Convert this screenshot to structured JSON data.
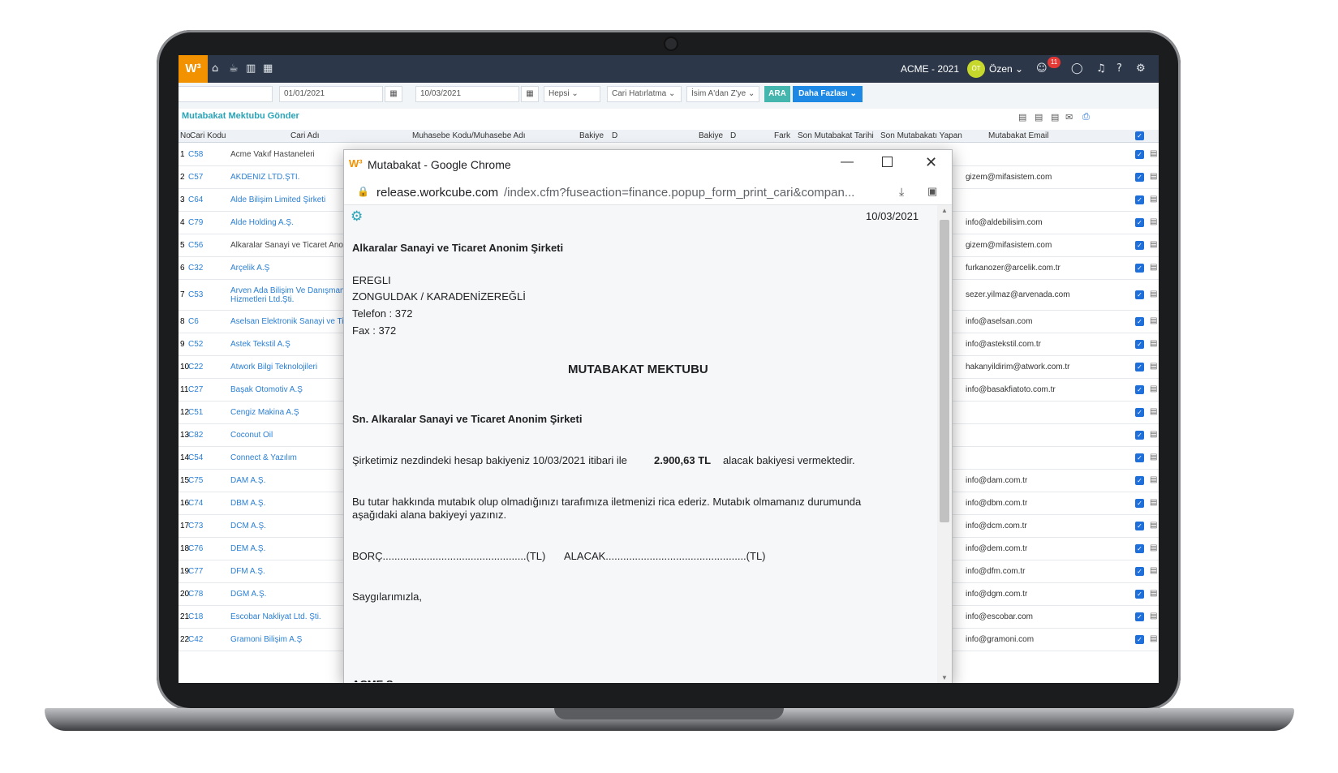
{
  "topbar": {
    "logo": "W³",
    "company": "ACME - 2021",
    "avatar": "ÖT",
    "user": "Özen ⌄",
    "badge": "11"
  },
  "filters": {
    "search": "",
    "date1": "01/01/2021",
    "date2": "10/03/2021",
    "type": "Hepsi",
    "reminder": "Cari Hatırlatma",
    "sort": "İsim A'dan Z'ye",
    "search_button": "ARA",
    "more_button": "Daha Fazlası"
  },
  "page_title": "Mutabakat Mektubu Gönder",
  "table": {
    "headers": [
      "No",
      "Cari Kodu",
      "Cari Adı",
      "Muhasebe Kodu/Muhasebe Adı",
      "Bakiye",
      "D",
      "Bakiye",
      "D",
      "Fark",
      "Son Mutabakat Tarihi",
      "Son Mutabakatı Yapan",
      "Mutabakat Email"
    ],
    "rows": [
      {
        "no": "1",
        "code": "C58",
        "name": "Acme Vakıf Hastaneleri",
        "email": ""
      },
      {
        "no": "2",
        "code": "C57",
        "name": "AKDENİZ LTD.ŞTİ.",
        "email": "gizem@mifasistem.com"
      },
      {
        "no": "3",
        "code": "C64",
        "name": "Alde Bilişim Limited Şirketi",
        "email": ""
      },
      {
        "no": "4",
        "code": "C79",
        "name": "Alde Holding A.Ş.",
        "email": "info@aldebilisim.com"
      },
      {
        "no": "5",
        "code": "C56",
        "name": "Alkaralar Sanayi ve Ticaret Anon",
        "email": "gizem@mifasistem.com"
      },
      {
        "no": "6",
        "code": "C32",
        "name": "Arçelik A.Ş",
        "email": "furkanozer@arcelik.com.tr"
      },
      {
        "no": "7",
        "code": "C53",
        "name": "Arven Ada Bilişim Ve Danışmanl",
        "name2": "Hizmetleri Ltd.Şti.",
        "email": "sezer.yilmaz@arvenada.com"
      },
      {
        "no": "8",
        "code": "C6",
        "name": "Aselsan Elektronik Sanayi ve Tic",
        "email": "info@aselsan.com"
      },
      {
        "no": "9",
        "code": "C52",
        "name": "Astek Tekstil A.Ş",
        "email": "info@astekstil.com.tr"
      },
      {
        "no": "10",
        "code": "C22",
        "name": "Atwork Bilgi Teknolojileri",
        "email": "hakanyildirim@atwork.com.tr"
      },
      {
        "no": "11",
        "code": "C27",
        "name": "Başak Otomotiv A.Ş",
        "email": "info@basakfiatoto.com.tr"
      },
      {
        "no": "12",
        "code": "C51",
        "name": "Cengiz Makina A.Ş",
        "email": ""
      },
      {
        "no": "13",
        "code": "C82",
        "name": "Coconut Oil",
        "email": ""
      },
      {
        "no": "14",
        "code": "C54",
        "name": "Connect & Yazılım",
        "email": ""
      },
      {
        "no": "15",
        "code": "C75",
        "name": "DAM A.Ş.",
        "email": "info@dam.com.tr"
      },
      {
        "no": "16",
        "code": "C74",
        "name": "DBM A.Ş.",
        "email": "info@dbm.com.tr"
      },
      {
        "no": "17",
        "code": "C73",
        "name": "DCM A.Ş.",
        "email": "info@dcm.com.tr"
      },
      {
        "no": "18",
        "code": "C76",
        "name": "DEM A.Ş.",
        "email": "info@dem.com.tr"
      },
      {
        "no": "19",
        "code": "C77",
        "name": "DFM A.Ş.",
        "email": "info@dfm.com.tr"
      },
      {
        "no": "20",
        "code": "C78",
        "name": "DGM A.Ş.",
        "email": "info@dgm.com.tr"
      },
      {
        "no": "21",
        "code": "C18",
        "name": "Escobar Nakliyat Ltd. Şti.",
        "email": "info@escobar.com"
      },
      {
        "no": "22",
        "code": "C42",
        "name": "Gramoni Bilişim A.Ş",
        "email": "info@gramoni.com"
      }
    ]
  },
  "popup": {
    "title": "Mutabakat - Google Chrome",
    "url_host": "release.workcube.com",
    "url_path": "/index.cfm?fuseaction=finance.popup_form_print_cari&compan...",
    "date": "10/03/2021",
    "company": "Alkaralar Sanayi ve Ticaret Anonim Şirketi",
    "addr1": "EREGLI",
    "addr2": "ZONGULDAK / KARADENİZEREĞLİ",
    "phone": "Telefon : 372",
    "fax": "Fax : 372",
    "heading": "MUTABAKAT MEKTUBU",
    "salutation": "Sn. Alkaralar Sanayi ve Ticaret Anonim Şirketi",
    "p1a": "Şirketimiz nezdindeki hesap bakiyeniz 10/03/2021 itibari ile",
    "amount": "2.900,63 TL",
    "p1b": "alacak bakiyesi vermektedir.",
    "p2a": "Bu tutar hakkında mutabık olup olmadığınızı tarafımıza iletmenizi rica ederiz. Mutabık olmamanız durumunda",
    "p2b": "aşağıdaki alana bakiyeyi yazınız.",
    "borc": "BORÇ.................................................(TL)",
    "alacak": "ALACAK................................................(TL)",
    "closing": "Saygılarımızla,",
    "footer": "ACME S..."
  }
}
